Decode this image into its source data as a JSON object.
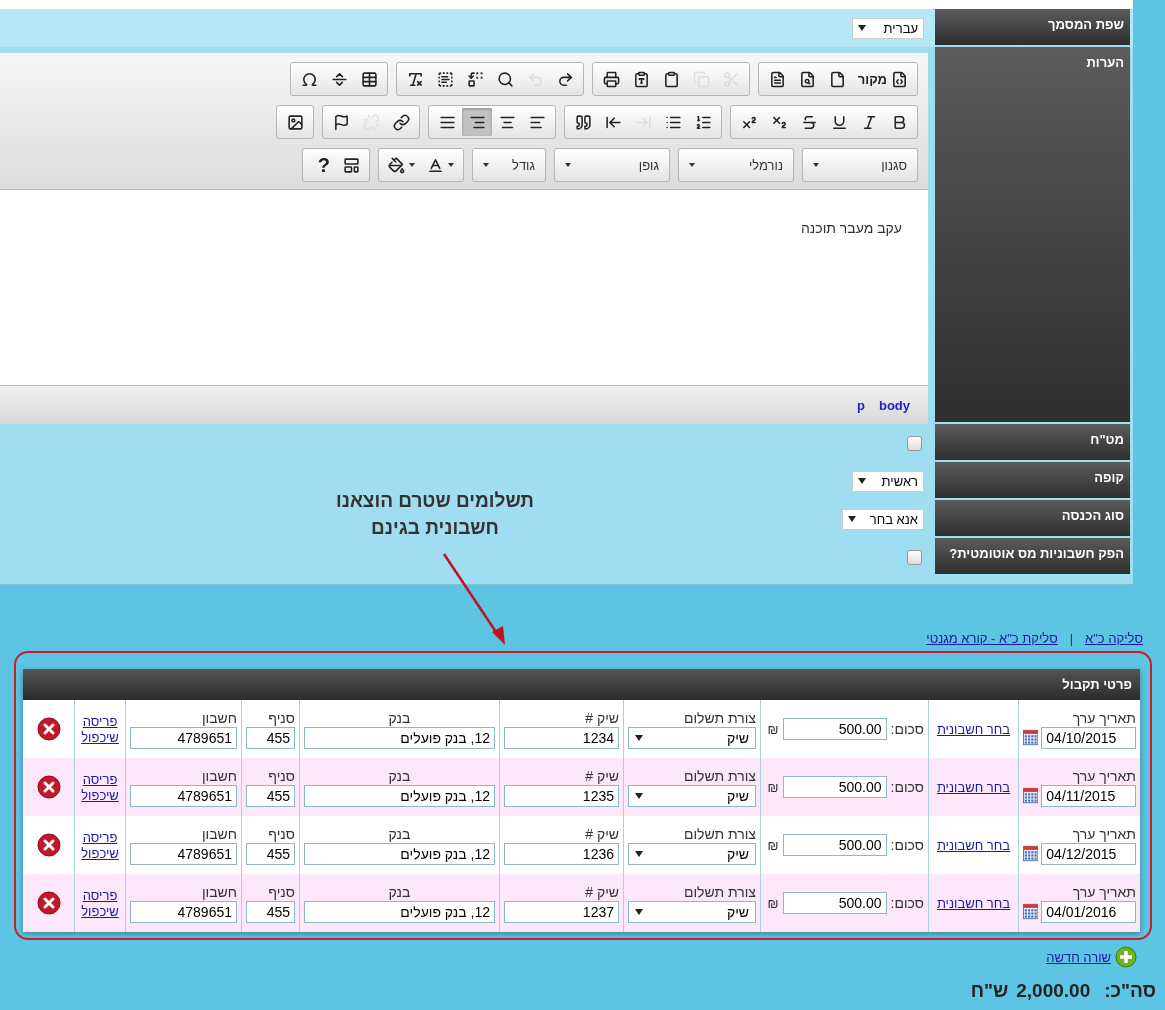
{
  "form": {
    "rows": [
      {
        "kind": "select",
        "label": "שפת המסמך",
        "value": "עברית"
      },
      {
        "kind": "editor",
        "label": "הערות"
      },
      {
        "kind": "checkbox",
        "label": "מט\"ח",
        "checked": false
      },
      {
        "kind": "select",
        "label": "קופה",
        "value": "ראשית"
      },
      {
        "kind": "select",
        "label": "סוג הכנסה",
        "value": "אנא בחר"
      },
      {
        "kind": "checkbox",
        "label": "הפק חשבוניות מס אוטומטית?",
        "checked": false
      }
    ]
  },
  "editor": {
    "toolbar": [
      [
        {
          "kind": "buttons",
          "buttons": [
            {
              "label": "מקור",
              "disabled": false
            },
            {
              "disabled": false
            },
            {
              "disabled": false
            },
            {
              "disabled": false
            }
          ]
        },
        {
          "kind": "buttons",
          "buttons": [
            {
              "disabled": true
            },
            {
              "disabled": true
            },
            {
              "disabled": false
            },
            {
              "disabled": false
            },
            {
              "disabled": false
            }
          ]
        },
        {
          "kind": "buttons",
          "buttons": [
            {
              "disabled": false
            },
            {
              "disabled": true
            },
            {
              "disabled": false
            },
            {
              "disabled": false
            },
            {
              "disabled": false
            },
            {
              "disabled": false
            }
          ]
        },
        {
          "kind": "buttons",
          "buttons": [
            {
              "disabled": false
            },
            {
              "disabled": false
            },
            {
              "disabled": false
            }
          ]
        }
      ],
      [
        {
          "kind": "buttons",
          "buttons": [
            {
              "disabled": false
            },
            {
              "disabled": false
            },
            {
              "disabled": false
            },
            {
              "disabled": false
            },
            {
              "disabled": false
            },
            {
              "disabled": false
            }
          ]
        },
        {
          "kind": "buttons",
          "buttons": [
            {
              "disabled": false
            },
            {
              "disabled": false
            },
            {
              "disabled": true
            },
            {
              "disabled": false
            },
            {
              "disabled": false
            }
          ]
        },
        {
          "kind": "buttons",
          "buttons": [
            {
              "disabled": false,
              "selected": false
            },
            {
              "disabled": false,
              "selected": false
            },
            {
              "disabled": false,
              "selected": true
            },
            {
              "disabled": false,
              "selected": false
            }
          ]
        },
        {
          "kind": "buttons",
          "buttons": [
            {
              "disabled": false
            },
            {
              "disabled": true
            },
            {
              "disabled": false
            }
          ]
        },
        {
          "kind": "buttons",
          "buttons": [
            {
              "disabled": false
            }
          ]
        }
      ],
      [
        {
          "kind": "combo",
          "label": "סגנון"
        },
        {
          "kind": "combo",
          "label": "נורמלי"
        },
        {
          "kind": "combo",
          "label": "גופן"
        },
        {
          "kind": "combo",
          "label": "גודל"
        },
        {
          "kind": "color",
          "buttons": [
            {
              "disabled": false
            },
            {
              "disabled": false
            }
          ]
        },
        {
          "kind": "buttons",
          "buttons": [
            {
              "disabled": false
            },
            {
              "label": "?",
              "disabled": false
            }
          ]
        }
      ]
    ],
    "content": "עקב מעבר תוכנה",
    "path": [
      "body",
      "p"
    ]
  },
  "annotation": {
    "text": "תשלומים שטרם הוצאנו\nחשבונית בגינם"
  },
  "payments": {
    "links": [
      "סליקה כ\"א",
      "סליקת כ\"א - קורא מגנטי"
    ],
    "separator": "|",
    "title": "פרטי תקבול",
    "rows": [
      {
        "date_label": "תאריך ערך",
        "date": "04/10/2015",
        "invoice_link": "בחר חשבונית",
        "amount_label": "סכום:",
        "amount": "500.00",
        "currency": "₪",
        "method_label": "צורת תשלום",
        "method": "שיק",
        "check_label": "שיק #",
        "check": "1234",
        "bank_label": "בנק",
        "bank": "12, בנק פועלים",
        "branch_label": "סניף",
        "branch": "455",
        "account_label": "חשבון",
        "account": "4789651",
        "actions": [
          "פריסה",
          "שיכפול"
        ]
      },
      {
        "date_label": "תאריך ערך",
        "date": "04/11/2015",
        "invoice_link": "בחר חשבונית",
        "amount_label": "סכום:",
        "amount": "500.00",
        "currency": "₪",
        "method_label": "צורת תשלום",
        "method": "שיק",
        "check_label": "שיק #",
        "check": "1235",
        "bank_label": "בנק",
        "bank": "12, בנק פועלים",
        "branch_label": "סניף",
        "branch": "455",
        "account_label": "חשבון",
        "account": "4789651",
        "actions": [
          "פריסה",
          "שיכפול"
        ]
      },
      {
        "date_label": "תאריך ערך",
        "date": "04/12/2015",
        "invoice_link": "בחר חשבונית",
        "amount_label": "סכום:",
        "amount": "500.00",
        "currency": "₪",
        "method_label": "צורת תשלום",
        "method": "שיק",
        "check_label": "שיק #",
        "check": "1236",
        "bank_label": "בנק",
        "bank": "12, בנק פועלים",
        "branch_label": "סניף",
        "branch": "455",
        "account_label": "חשבון",
        "account": "4789651",
        "actions": [
          "פריסה",
          "שיכפול"
        ]
      },
      {
        "date_label": "תאריך ערך",
        "date": "04/01/2016",
        "invoice_link": "בחר חשבונית",
        "amount_label": "סכום:",
        "amount": "500.00",
        "currency": "₪",
        "method_label": "צורת תשלום",
        "method": "שיק",
        "check_label": "שיק #",
        "check": "1237",
        "bank_label": "בנק",
        "bank": "12, בנק פועלים",
        "branch_label": "סניף",
        "branch": "455",
        "account_label": "חשבון",
        "account": "4789651",
        "actions": [
          "פריסה",
          "שיכפול"
        ]
      }
    ],
    "add_row": "שורה חדשה",
    "total": {
      "label": "סה\"כ:",
      "value": "2,000.00",
      "currency": "ש\"ח"
    }
  }
}
